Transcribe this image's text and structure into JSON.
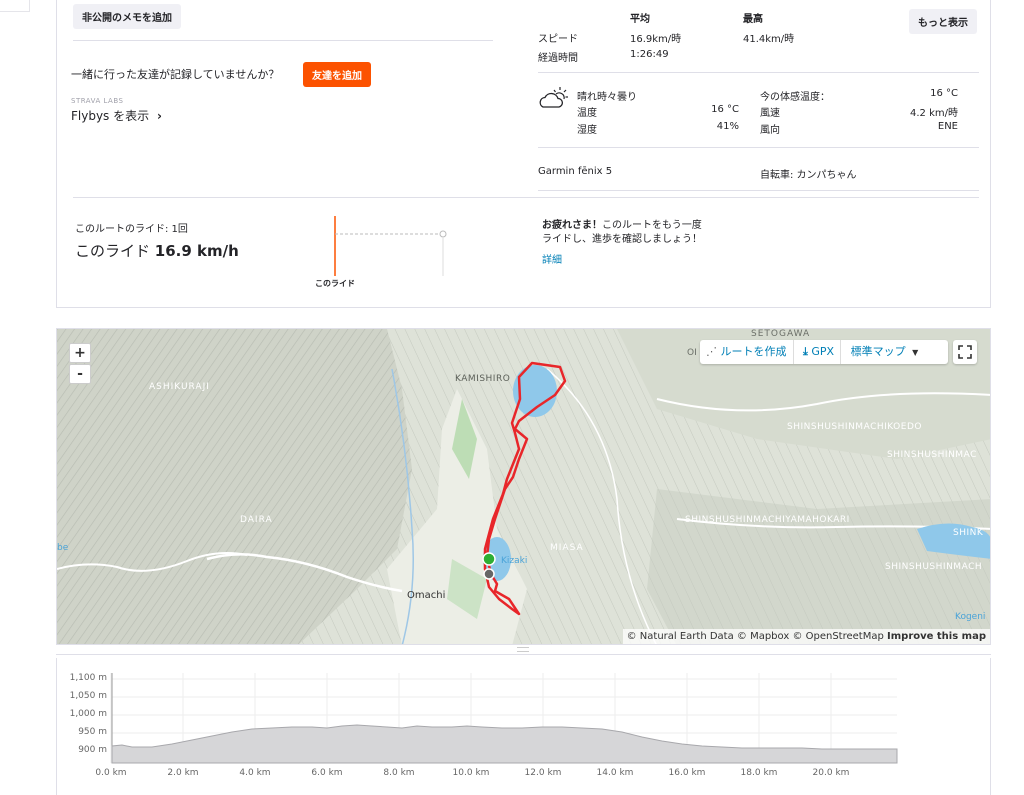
{
  "summary": {
    "add_private_note": "非公開のメモを追加",
    "friends_prompt": "一緒に行った友達が記録していませんか？",
    "add_friends": "友達を追加",
    "strava_labs": "STRAVA LABS",
    "flybys": "Flybys を表示",
    "show_more": "もっと表示"
  },
  "stats": {
    "header_avg": "平均",
    "header_max": "最高",
    "speed_label": "スピード",
    "speed_avg": "16.9km/時",
    "speed_max": "41.4km/時",
    "elapsed_label": "経過時間",
    "elapsed_value": "1:26:49"
  },
  "weather": {
    "condition": "晴れ時々曇り",
    "temp_label": "温度",
    "temp_value": "16 °C",
    "humidity_label": "湿度",
    "humidity_value": "41%",
    "feels_label": "今の体感温度：",
    "feels_value": "16 °C",
    "wind_speed_label": "風速",
    "wind_speed_value": "4.2 km/時",
    "wind_dir_label": "風向",
    "wind_dir_value": "ENE"
  },
  "device": {
    "device_name": "Garmin fēnix 5",
    "bike": "自転車: カンパちゃん"
  },
  "route": {
    "rides_label": "このルートのライド: 1回",
    "this_ride_prefix": "このライド ",
    "this_ride_speed": "16.9 km/h",
    "chart_label": "このライド",
    "congrats_bold": "お疲れさま！",
    "congrats_text_1": "このルートをもう一度",
    "congrats_text_2": "ライドし、進歩を確認しましょう！",
    "details_link": "詳細"
  },
  "map": {
    "zoom_in": "+",
    "zoom_out": "-",
    "create_route": "ルートを作成",
    "gpx": "GPX",
    "map_type": "標準マップ",
    "attribution": "© Natural Earth Data © Mapbox © OpenStreetMap",
    "improve": "Improve this map",
    "places": {
      "setogawa": "SETOGAWA",
      "kamishiro": "KAMISHIRO",
      "ashikuraji": "ASHIKURAJI",
      "shinmachikoedo": "SHINSHUSHINMACHIKOEDO",
      "shinmac": "SHINSHUSHINMAC",
      "yamahokari": "SHINSHUSHINMACHIYAMAHOKARI",
      "daira": "DAIRA",
      "miasa": "MIASA",
      "kizaki": "Kizaki",
      "shink": "SHINK",
      "shinmach": "SHINSHUSHINMACH",
      "omachi": "Omachi",
      "kogeni": "Kogeni",
      "be": "be",
      "oi": "OI"
    },
    "colors": {
      "route": "#e8262a",
      "water": "#8fc8ea",
      "start": "#2eae33"
    }
  },
  "elevation": {
    "y_ticks": [
      "1,100 m",
      "1,050 m",
      "1,000 m",
      "950 m",
      "900 m"
    ],
    "x_ticks": [
      "0.0 km",
      "2.0 km",
      "4.0 km",
      "6.0 km",
      "8.0 km",
      "10.0 km",
      "12.0 km",
      "14.0 km",
      "16.0 km",
      "18.0 km",
      "20.0 km"
    ]
  },
  "colors": {
    "accent": "#fc5200",
    "link": "#007fb6"
  }
}
